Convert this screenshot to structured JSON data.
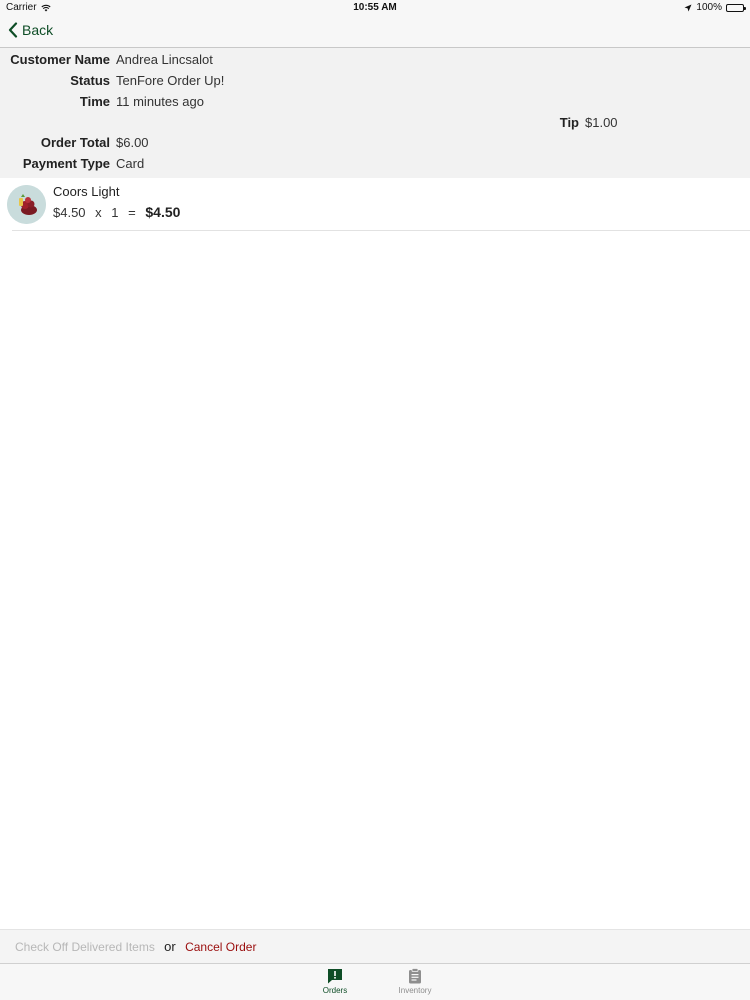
{
  "status_bar": {
    "carrier": "Carrier",
    "time": "10:55 AM",
    "battery": "100%",
    "battery_level": 1.0
  },
  "nav": {
    "back_label": "Back",
    "accent_color": "#0e4d26"
  },
  "order": {
    "customer_name_label": "Customer Name",
    "customer_name": "Andrea Lincsalot",
    "status_label": "Status",
    "status": "TenFore Order Up!",
    "time_label": "Time",
    "time": "11 minutes ago",
    "tip_label": "Tip",
    "tip": "$1.00",
    "total_label": "Order Total",
    "total": "$6.00",
    "payment_label": "Payment Type",
    "payment": "Card"
  },
  "items": [
    {
      "name": "Coors Light",
      "unit_price": "$4.50",
      "times": "x",
      "quantity": "1",
      "equals": "=",
      "line_total": "$4.50",
      "icon": "beer-item-icon"
    }
  ],
  "actions": {
    "check_off_label": "Check Off Delivered Items",
    "or_label": "or",
    "cancel_label": "Cancel Order",
    "cancel_color": "#9a0d0d"
  },
  "tabs": [
    {
      "label": "Orders",
      "icon": "orders-icon",
      "selected": true
    },
    {
      "label": "Inventory",
      "icon": "clipboard-icon",
      "selected": false
    }
  ]
}
